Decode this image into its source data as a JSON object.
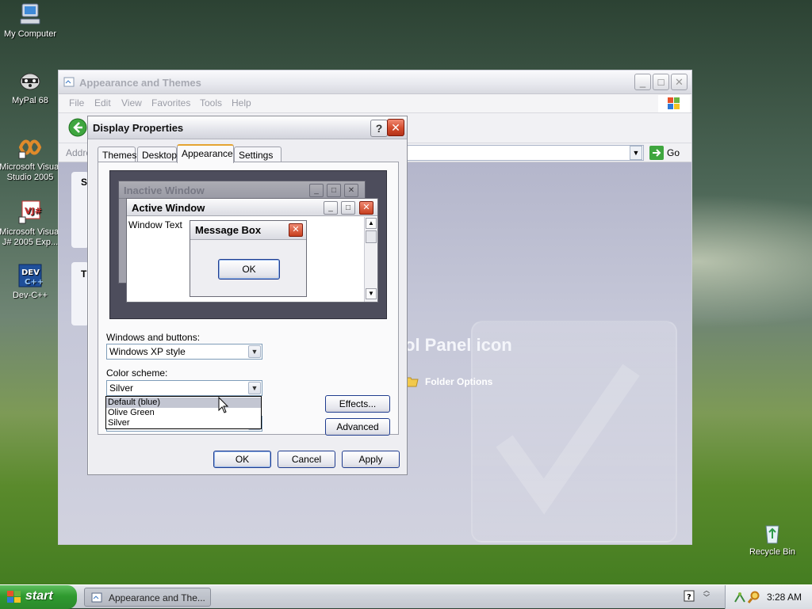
{
  "desktop": {
    "icons": [
      {
        "label": "My Computer"
      },
      {
        "label": "MyPal 68"
      },
      {
        "label": "Microsoft Visual Studio 2005"
      },
      {
        "label": "Microsoft Visual J# 2005 Exp..."
      },
      {
        "label": "Dev-C++"
      },
      {
        "label": "Recycle Bin"
      }
    ]
  },
  "explorer": {
    "title": "Appearance and Themes",
    "menu": [
      "File",
      "Edit",
      "View",
      "Favorites",
      "Tools",
      "Help"
    ],
    "address_label": "Addre",
    "go_label": "Go",
    "heading": "ol Panel icon",
    "folder_options": "Folder Options",
    "side_letter_1": "S",
    "side_letter_2": "T"
  },
  "dialog": {
    "title": "Display Properties",
    "help": "?",
    "tabs": [
      "Themes",
      "Desktop",
      "Appearance",
      "Settings"
    ],
    "active_tab": "Appearance",
    "preview": {
      "inactive_title": "Inactive Window",
      "active_title": "Active Window",
      "window_text": "Window Text",
      "msgbox_title": "Message Box",
      "msgbox_ok": "OK"
    },
    "windows_buttons_label": "Windows and buttons:",
    "windows_buttons_value": "Windows XP style",
    "color_scheme_label": "Color scheme:",
    "color_scheme_value": "Silver",
    "color_scheme_options": [
      "Default (blue)",
      "Olive Green",
      "Silver"
    ],
    "effects_label": "Effects...",
    "advanced_label": "Advanced",
    "ok_label": "OK",
    "cancel_label": "Cancel",
    "apply_label": "Apply"
  },
  "taskbar": {
    "start_label": "start",
    "task_label": "Appearance and The...",
    "clock": "3:28 AM"
  }
}
